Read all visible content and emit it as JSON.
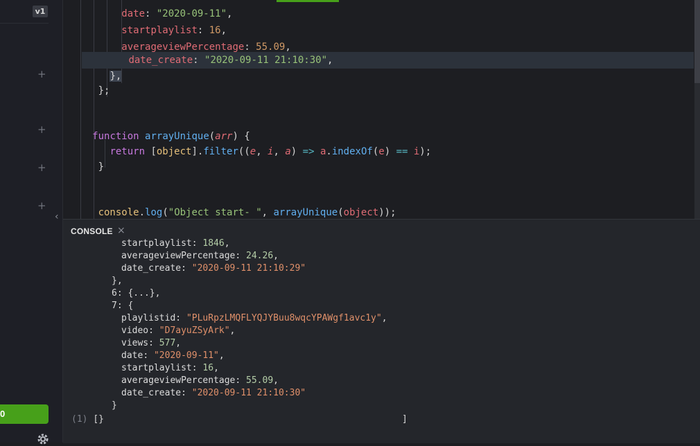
{
  "sidebar": {
    "version": "v1",
    "run_label": "0"
  },
  "editor": {
    "lines": [
      {
        "indent": "          ",
        "key": "date",
        "value": "\"2020-09-11\"",
        "vtype": "str",
        "tail": ","
      },
      {
        "indent": "          ",
        "key": "startplaylist",
        "value": "16",
        "vtype": "num",
        "tail": ","
      },
      {
        "indent": "          ",
        "key": "averageviewPercentage",
        "value": "55.09",
        "vtype": "num",
        "tail": ","
      },
      {
        "indent": "          ",
        "key": "date_create",
        "value": "\"2020-09-11 21:10:30\"",
        "vtype": "str",
        "tail": ","
      }
    ],
    "close_brace": "},",
    "close_array": "};",
    "func_keyword": "function",
    "func_name": "arrayUnique",
    "func_param": "arr",
    "func_open": " {",
    "return_keyword": "return",
    "return_obj": "object",
    "return_filter": "filter",
    "return_e": "e",
    "return_i": "i",
    "return_a": "a",
    "return_indexof": "indexOf",
    "func_close": "}",
    "console_obj": "console",
    "console_log": "log",
    "console_str": "\"Object start- \"",
    "console_call": "arrayUnique",
    "console_arg": "object"
  },
  "console": {
    "title": "CONSOLE",
    "close": "×",
    "lines": [
      {
        "indent": "        ",
        "key": "startplaylist",
        "value": "1846",
        "vtype": "num",
        "tail": ","
      },
      {
        "indent": "        ",
        "key": "averageviewPercentage",
        "value": "24.26",
        "vtype": "num",
        "tail": ","
      },
      {
        "indent": "        ",
        "key": "date_create",
        "value": "\"2020-09-11 21:10:29\"",
        "vtype": "str",
        "tail": ""
      },
      {
        "indent": "      ",
        "raw": "},"
      },
      {
        "indent": "      ",
        "raw": "6: {...},"
      },
      {
        "indent": "      ",
        "raw": "7: {"
      },
      {
        "indent": "        ",
        "key": "playlistid",
        "value": "\"PLuRpzLMQFLYQJYBuu8wqcYPAWgf1avc1y\"",
        "vtype": "str",
        "tail": ","
      },
      {
        "indent": "        ",
        "key": "video",
        "value": "\"D7ayuZSyArk\"",
        "vtype": "str",
        "tail": ","
      },
      {
        "indent": "        ",
        "key": "views",
        "value": "577",
        "vtype": "num",
        "tail": ","
      },
      {
        "indent": "        ",
        "key": "date",
        "value": "\"2020-09-11\"",
        "vtype": "str",
        "tail": ","
      },
      {
        "indent": "        ",
        "key": "startplaylist",
        "value": "16",
        "vtype": "num",
        "tail": ","
      },
      {
        "indent": "        ",
        "key": "averageviewPercentage",
        "value": "55.09",
        "vtype": "num",
        "tail": ","
      },
      {
        "indent": "        ",
        "key": "date_create",
        "value": "\"2020-09-11 21:10:30\"",
        "vtype": "str",
        "tail": ""
      },
      {
        "indent": "      ",
        "raw": "}"
      }
    ],
    "result_count": "(1)",
    "result_value": "[}",
    "result_close": "]"
  }
}
